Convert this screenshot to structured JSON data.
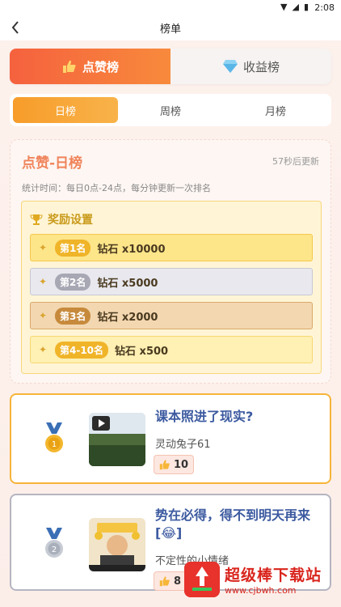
{
  "status_bar": {
    "time": "2:08"
  },
  "nav": {
    "title": "榜单"
  },
  "main_tabs": [
    {
      "label": "点赞榜",
      "icon": "thumb-up-icon",
      "active": true
    },
    {
      "label": "收益榜",
      "icon": "diamond-icon",
      "active": false
    }
  ],
  "sub_tabs": [
    {
      "label": "日榜",
      "active": true
    },
    {
      "label": "周榜",
      "active": false
    },
    {
      "label": "月榜",
      "active": false
    }
  ],
  "card": {
    "title_a": "点赞",
    "title_b": "-日榜",
    "refresh": "57秒后更新",
    "stat": "统计时间：每日0点-24点，每分钟更新一次排名"
  },
  "reward": {
    "title": "奖励设置",
    "ranks": [
      {
        "badge": "第1名",
        "prize": "钻石 x10000"
      },
      {
        "badge": "第2名",
        "prize": "钻石 x5000"
      },
      {
        "badge": "第3名",
        "prize": "钻石 x2000"
      },
      {
        "badge": "第4-10名",
        "prize": "钻石 x500"
      }
    ]
  },
  "entries": [
    {
      "rank": "1",
      "title": "课本照进了现实?",
      "author": "灵动兔子61",
      "likes": "10"
    },
    {
      "rank": "2",
      "title": "势在必得，得不到明天再来[😂]",
      "author": "不定性的小情绪",
      "likes": "8"
    }
  ],
  "watermark": {
    "main": "超级棒下载站",
    "sub": "www.cjbwh.com"
  },
  "colors": {
    "accent_orange": "#f5613e",
    "sub_tab_active": "#f79c2a",
    "gold": "#f0b429",
    "silver": "#a8a8b4",
    "bronze": "#c78a3c",
    "title_blue": "#3c5aa0"
  }
}
